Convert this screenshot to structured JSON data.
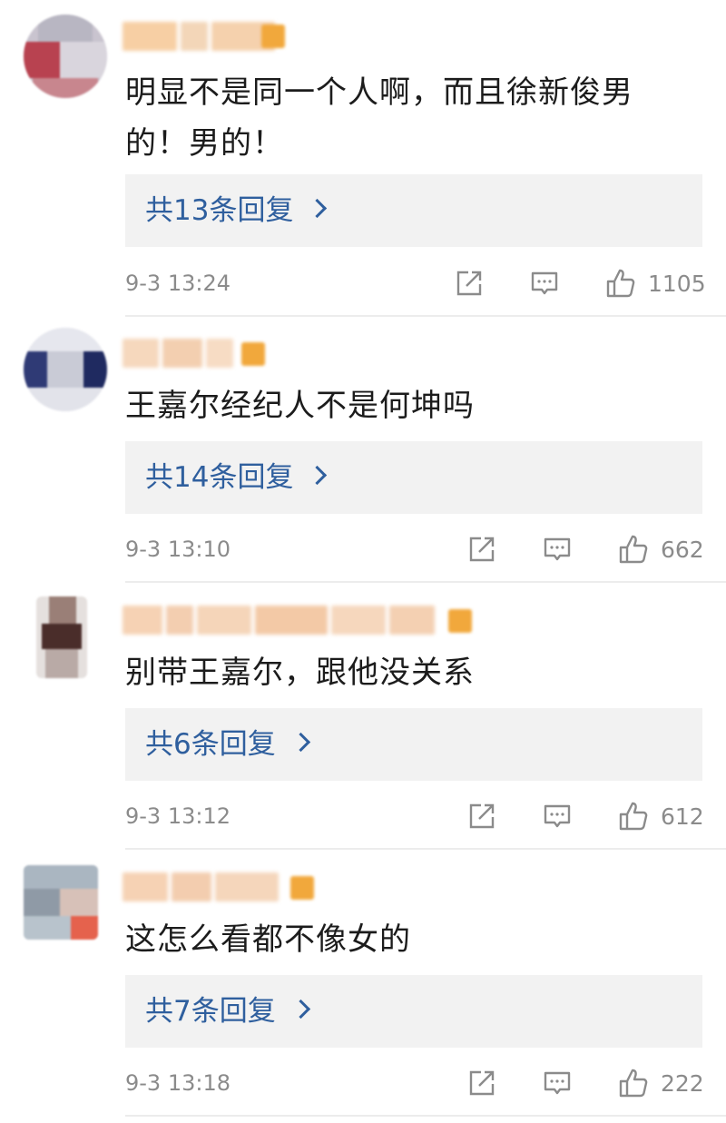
{
  "comments": [
    {
      "text": "明显不是同一个人啊，而且徐新俊男的！男的！",
      "replies": "共13条回复",
      "time": "9-3 13:24",
      "likes": "1105"
    },
    {
      "text": "王嘉尔经纪人不是何坤吗",
      "replies": "共14条回复",
      "time": "9-3 13:10",
      "likes": "662"
    },
    {
      "text": "别带王嘉尔，跟他没关系",
      "replies": "共6条回复",
      "time": "9-3 13:12",
      "likes": "612"
    },
    {
      "text": "这怎么看都不像女的",
      "replies": "共7条回复",
      "time": "9-3 13:18",
      "likes": "222"
    }
  ],
  "icons": {
    "share": "share-icon",
    "reply": "comment-icon",
    "like": "thumbs-up-icon",
    "chevron": "chevron-right-icon"
  },
  "colors": {
    "reply_link": "#2f5f9e",
    "meta_text": "#8b8b8b",
    "reply_box_bg": "#f2f2f2",
    "badge": "#f1a83c"
  }
}
